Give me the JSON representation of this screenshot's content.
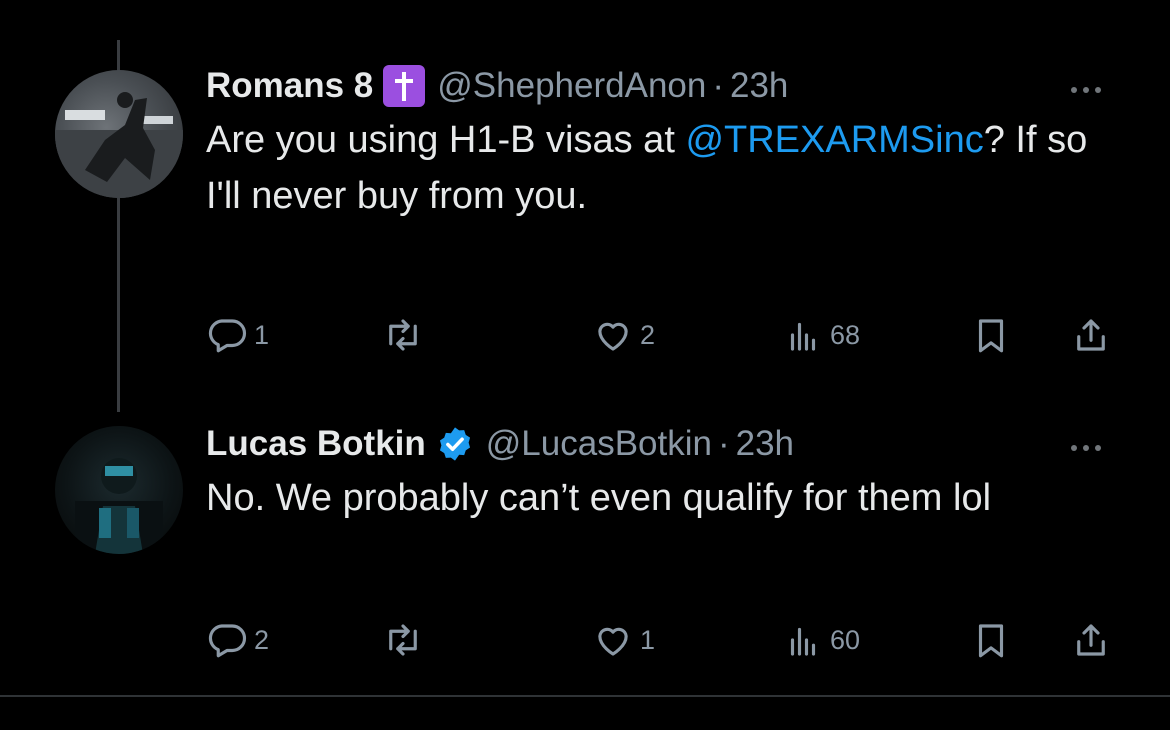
{
  "tweets": [
    {
      "display_name": "Romans 8",
      "badge_icon": "cross-icon",
      "handle": "@ShepherdAnon",
      "dot": "·",
      "time": "23h",
      "text_before": "Are you using H1-B visas at ",
      "mention": "@TREXARMSinc",
      "text_after": "? If so I'll never buy from you.",
      "replies": "1",
      "retweets": "",
      "likes": "2",
      "views": "68"
    },
    {
      "display_name": "Lucas Botkin",
      "badge_icon": "verified-check-icon",
      "handle": "@LucasBotkin",
      "dot": "·",
      "time": "23h",
      "text": "No. We probably can’t even qualify for them lol",
      "replies": "2",
      "retweets": "",
      "likes": "1",
      "views": "60"
    }
  ],
  "colors": {
    "background": "#000000",
    "text": "#e7e9ea",
    "muted": "#8b98a5",
    "link": "#1d9bf0",
    "verified": "#1d9bf0",
    "cross_badge": "#9b4fe0",
    "thread_line": "#3a3d41"
  },
  "icons": [
    "more-icon",
    "reply-icon",
    "retweet-icon",
    "like-icon",
    "views-icon",
    "bookmark-icon",
    "share-icon"
  ]
}
